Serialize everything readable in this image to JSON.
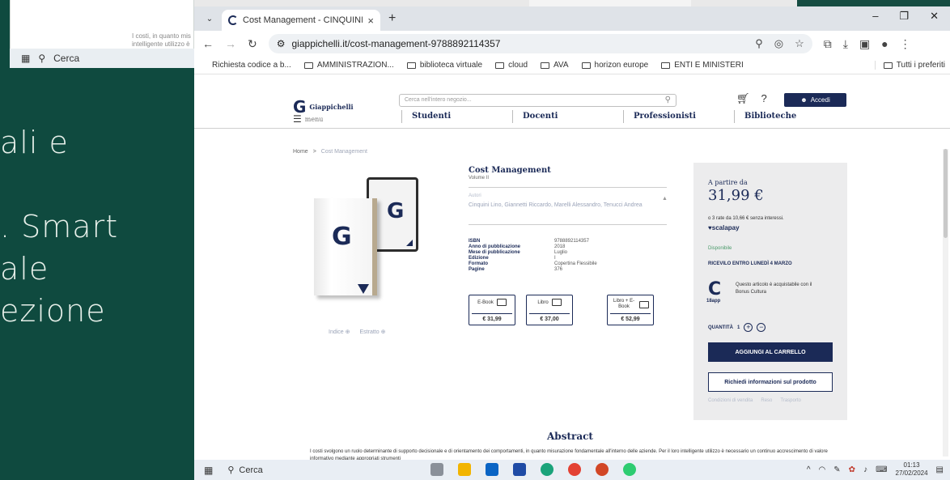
{
  "background": {
    "slide_lines": [
      "ali e",
      "",
      ". Smart",
      "ale",
      "ezione"
    ],
    "bg_window_text": [
      "I costi, in quanto mis",
      "intelligente utilizzo è"
    ],
    "bg_taskbar_search": "Cerca"
  },
  "browser": {
    "tab_title": "Cost Management - CINQUINI",
    "url": "giappichelli.it/cost-management-9788892114357",
    "bookmarks": [
      "Richiesta codice a b...",
      "AMMINISTRAZION...",
      "biblioteca virtuale",
      "cloud",
      "AVA",
      "horizon europe",
      "ENTI E MINISTERI"
    ],
    "bookmarks_right": "Tutti i preferiti"
  },
  "site": {
    "logo": "Giappichelli",
    "menu": "menu",
    "search_placeholder": "Cerca nell'intero negozio...",
    "login": "Accedi",
    "nav": [
      "Studenti",
      "Docenti",
      "Professionisti",
      "Biblioteche"
    ],
    "breadcrumb": {
      "home": "Home",
      "sep": ">",
      "current": "Cost Management"
    },
    "image_links": {
      "index": "Indice",
      "excerpt": "Estratto"
    }
  },
  "product": {
    "title": "Cost Management",
    "subtitle": "Volume II",
    "authors_label": "Autori",
    "authors": "Cinquini Lino, Giannetti Riccardo, Marelli Alessandro, Tenucci Andrea",
    "specs": [
      {
        "k": "ISBN",
        "v": "9788892114357"
      },
      {
        "k": "Anno di pubblicazione",
        "v": "2018"
      },
      {
        "k": "Mese di pubblicazione",
        "v": "Luglio"
      },
      {
        "k": "Edizione",
        "v": "I"
      },
      {
        "k": "Formato",
        "v": "Copertina Flessibile"
      },
      {
        "k": "Pagine",
        "v": "376"
      }
    ],
    "formats": [
      {
        "label": "E-Book",
        "price": "€ 31,99"
      },
      {
        "label": "Libro",
        "price": "€ 37,00"
      },
      {
        "label": "Libro + E-Book",
        "price": "€ 52,99"
      }
    ]
  },
  "buy": {
    "from_label": "A partire da",
    "price": "31,99 €",
    "installments": "o 3 rate da 10,66 € senza interessi.",
    "scalapay": "♥scalapay",
    "availability": "Disponibile",
    "delivery": "RICEVILO ENTRO LUNEDÌ 4 MARZO",
    "app_name": "18app",
    "bonus": "Questo articolo è acquistabile con il Bonus Cultura",
    "qty_label": "QUANTITÀ",
    "qty": "1",
    "add_to_cart": "AGGIUNGI AL CARRELLO",
    "info_request": "Richiedi informazioni sul prodotto",
    "links": [
      "Condizioni di vendita",
      "Reso",
      "Trasporto"
    ]
  },
  "abstract": {
    "title": "Abstract",
    "text": "I costi svolgono un ruolo determinante di supporto decisionale e di orientamento dei comportamenti, in quanto misurazione fondamentale all'interno delle aziende. Per il loro intelligente utilizzo è necessario un continuo accrescimento di valore informativo mediante appropriati strumenti"
  },
  "taskbar": {
    "search": "Cerca",
    "time": "01:13",
    "date": "27/02/2024"
  }
}
